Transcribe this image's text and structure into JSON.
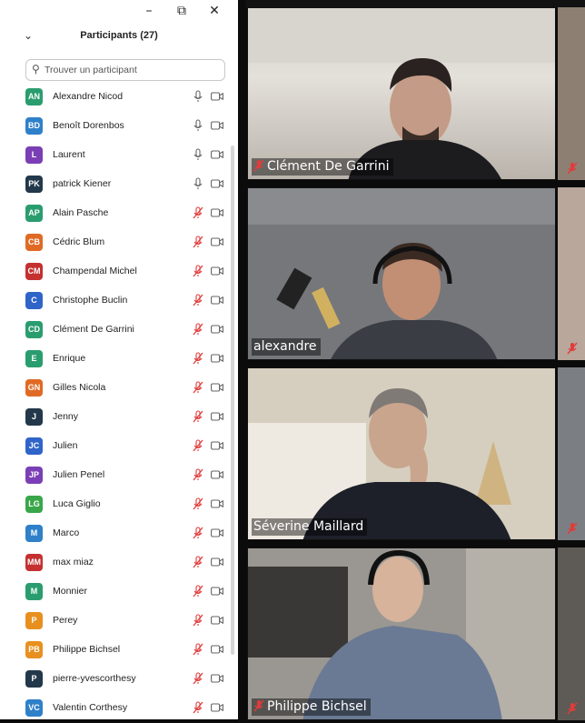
{
  "window_controls": {
    "minimize": "–",
    "restore": "⧉",
    "close": "✕"
  },
  "panel": {
    "title": "Participants (27)",
    "collapse_icon": "chevron-down-icon",
    "search_placeholder": "Trouver un participant"
  },
  "participants": [
    {
      "initials": "AN",
      "name": "Alexandre Nicod",
      "color": "#2a9d6f",
      "muted": false
    },
    {
      "initials": "BD",
      "name": "Benoît Dorenbos",
      "color": "#2f80c9",
      "muted": false
    },
    {
      "initials": "L",
      "name": "Laurent",
      "color": "#7b3fb5",
      "muted": false
    },
    {
      "initials": "PK",
      "name": "patrick Kiener",
      "color": "#23384a",
      "muted": false
    },
    {
      "initials": "AP",
      "name": "Alain Pasche",
      "color": "#2a9d6f",
      "muted": true
    },
    {
      "initials": "CB",
      "name": "Cédric Blum",
      "color": "#e06a24",
      "muted": true
    },
    {
      "initials": "CM",
      "name": "Champendal Michel",
      "color": "#c53030",
      "muted": true
    },
    {
      "initials": "C",
      "name": "Christophe Buclin",
      "color": "#2f64c9",
      "muted": true
    },
    {
      "initials": "CD",
      "name": "Clément De Garrini",
      "color": "#2a9d6f",
      "muted": true
    },
    {
      "initials": "E",
      "name": "Enrique",
      "color": "#2a9d6f",
      "muted": true
    },
    {
      "initials": "GN",
      "name": "Gilles Nicola",
      "color": "#e06a24",
      "muted": true
    },
    {
      "initials": "J",
      "name": "Jenny",
      "color": "#23384a",
      "muted": true
    },
    {
      "initials": "JC",
      "name": "Julien",
      "color": "#2f64c9",
      "muted": true
    },
    {
      "initials": "JP",
      "name": "Julien Penel",
      "color": "#7b3fb5",
      "muted": true
    },
    {
      "initials": "LG",
      "name": "Luca Giglio",
      "color": "#3aa64a",
      "muted": true
    },
    {
      "initials": "M",
      "name": "Marco",
      "color": "#2f80c9",
      "muted": true
    },
    {
      "initials": "MM",
      "name": "max miaz",
      "color": "#c53030",
      "muted": true
    },
    {
      "initials": "M",
      "name": "Monnier",
      "color": "#2a9d6f",
      "muted": true
    },
    {
      "initials": "P",
      "name": "Perey",
      "color": "#e8901f",
      "muted": true
    },
    {
      "initials": "PB",
      "name": "Philippe Bichsel",
      "color": "#e8901f",
      "muted": true
    },
    {
      "initials": "P",
      "name": "pierre-yvescorthesy",
      "color": "#23384a",
      "muted": true
    },
    {
      "initials": "VC",
      "name": "Valentin Corthesy",
      "color": "#2f80c9",
      "muted": true
    }
  ],
  "tiles": [
    {
      "name": "Clément De Garrini",
      "muted": true
    },
    {
      "name": "alexandre",
      "muted": false
    },
    {
      "name": "Séverine Maillard",
      "muted": false
    },
    {
      "name": "Philippe Bichsel",
      "muted": true
    }
  ]
}
